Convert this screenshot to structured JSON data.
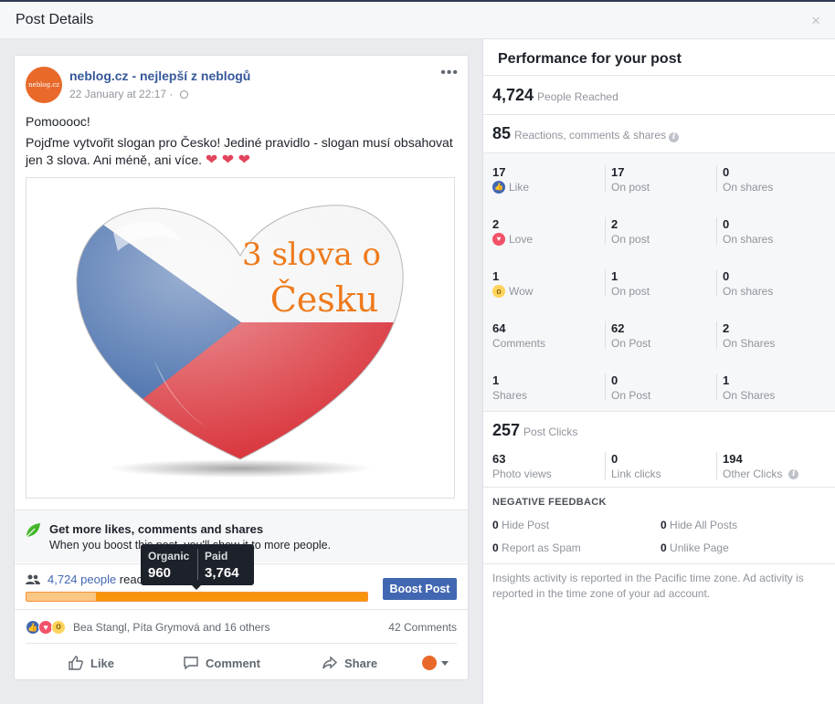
{
  "dialog": {
    "title": "Post Details",
    "close": "×"
  },
  "post": {
    "avatar_text": "neblog.cz",
    "page_name": "neblog.cz - nejlepší z neblogů",
    "date": "22 January at 22:17",
    "date_sep": "·",
    "more": "•••",
    "text_line1": "Pomooooc!",
    "text_line2": "Pojďme vytvořit slogan pro Česko! Jediné pravidlo - slogan musí obsahovat jen 3 slova. Ani méně, ani více.",
    "hearts": "❤ ❤ ❤",
    "image_text_line1": "3 slova o",
    "image_text_line2": "Česku"
  },
  "boost": {
    "title": "Get more likes, comments and shares",
    "subtitle": "When you boost this post, you'll show it to more people.",
    "button": "Boost Post"
  },
  "reach": {
    "link": "4,724 people",
    "suffix": " reached",
    "organic_fraction": 0.203,
    "tooltip": {
      "organic_label": "Organic",
      "organic_value": "960",
      "paid_label": "Paid",
      "paid_value": "3,764"
    }
  },
  "reactions": {
    "names": "Bea Stangl, Píta Grymová and 16 others",
    "comments": "42 Comments"
  },
  "actions": {
    "like": "Like",
    "comment": "Comment",
    "share": "Share"
  },
  "performance": {
    "title": "Performance for your post",
    "reached_value": "4,724",
    "reached_label": "People Reached",
    "engagement_value": "85",
    "engagement_label": "Reactions, comments & shares",
    "rows": [
      {
        "v1": "17",
        "l1": "Like",
        "icon": "like",
        "v2": "17",
        "l2": "On post",
        "v3": "0",
        "l3": "On shares"
      },
      {
        "v1": "2",
        "l1": "Love",
        "icon": "love",
        "v2": "2",
        "l2": "On post",
        "v3": "0",
        "l3": "On shares"
      },
      {
        "v1": "1",
        "l1": "Wow",
        "icon": "wow",
        "v2": "1",
        "l2": "On post",
        "v3": "0",
        "l3": "On shares"
      },
      {
        "v1": "64",
        "l1": "Comments",
        "icon": "",
        "v2": "62",
        "l2": "On Post",
        "v3": "2",
        "l3": "On Shares"
      },
      {
        "v1": "1",
        "l1": "Shares",
        "icon": "",
        "v2": "0",
        "l2": "On Post",
        "v3": "1",
        "l3": "On Shares"
      }
    ],
    "clicks_value": "257",
    "clicks_label": "Post Clicks",
    "photo_views": "63",
    "photo_views_label": "Photo views",
    "link_clicks": "0",
    "link_clicks_label": "Link clicks",
    "other_clicks": "194",
    "other_clicks_label": "Other Clicks",
    "negative_title": "NEGATIVE FEEDBACK",
    "hide_post_value": "0",
    "hide_post_label": "Hide Post",
    "hide_all_value": "0",
    "hide_all_label": "Hide All Posts",
    "spam_value": "0",
    "spam_label": "Report as Spam",
    "unlike_value": "0",
    "unlike_label": "Unlike Page",
    "footnote": "Insights activity is reported in the Pacific time zone. Ad activity is reported in the time zone of your ad account."
  },
  "colors": {
    "brand_blue": "#4267b2",
    "link_blue": "#365899",
    "organic": "#fbc784",
    "paid": "#f7940a",
    "page_orange": "#e8692a"
  }
}
